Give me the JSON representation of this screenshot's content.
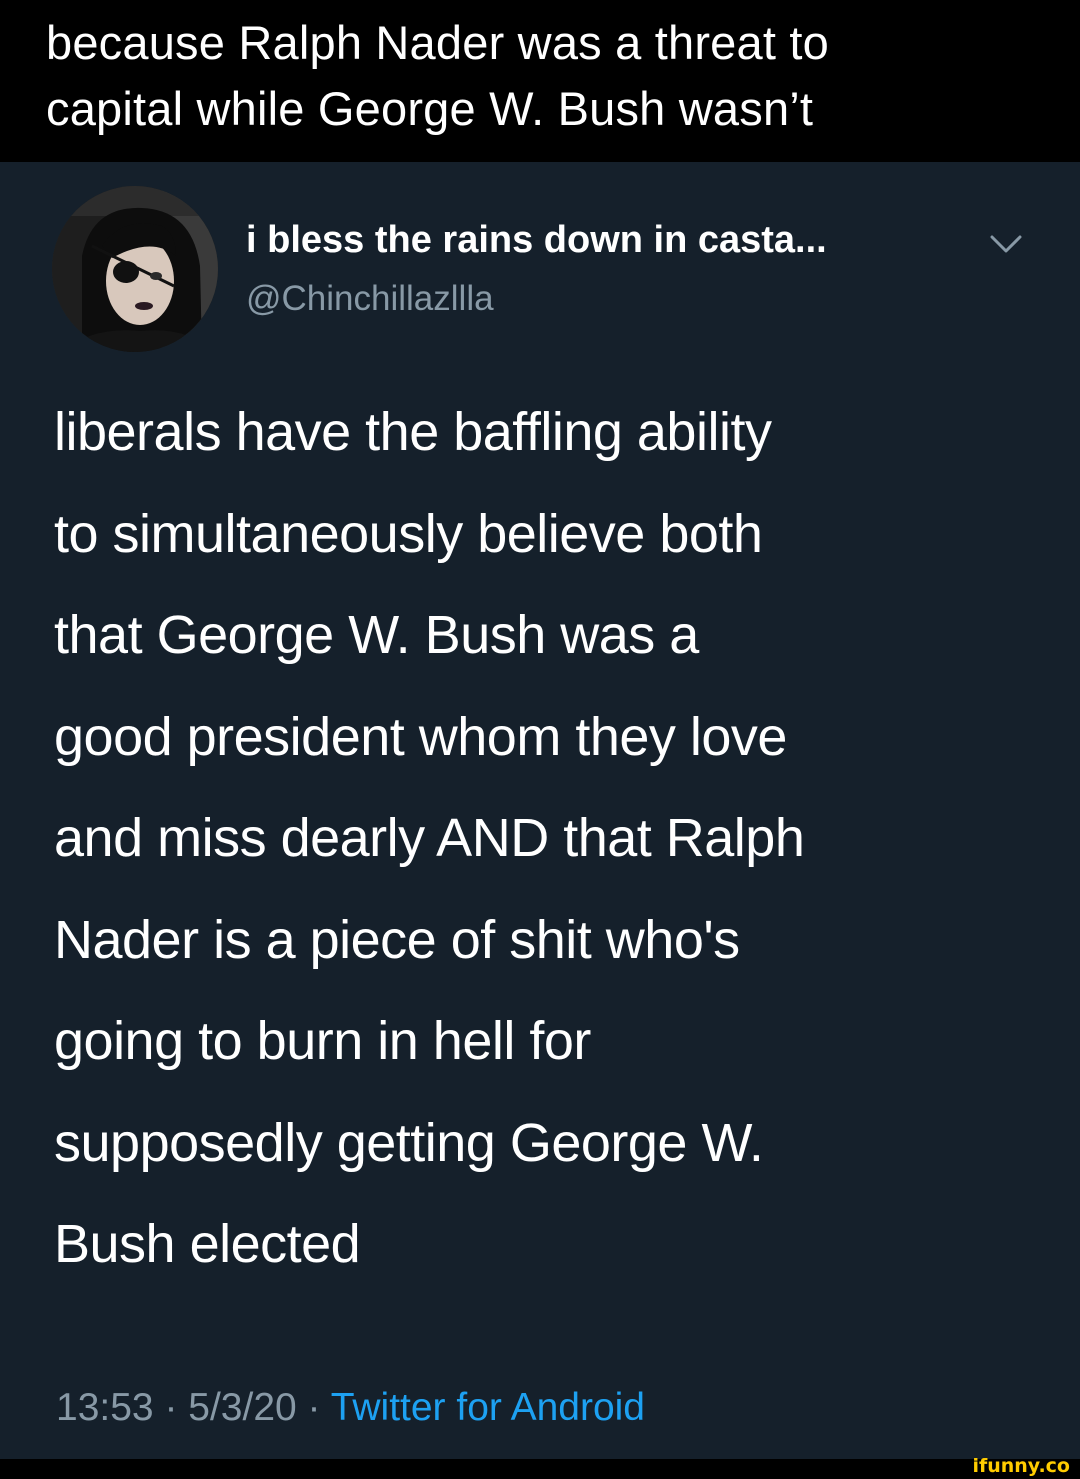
{
  "caption": {
    "line1": "because Ralph Nader was a threat to",
    "line2": "capital while George W. Bush wasn’t"
  },
  "tweet": {
    "display_name": "i bless the rains down in casta...",
    "handle": "@Chinchillazllla",
    "lines": [
      "liberals have the baffling ability",
      "to simultaneously believe both",
      "that George W. Bush was a",
      "good president whom they love",
      "and miss dearly AND that Ralph",
      "Nader is a piece of shit who's",
      "going to burn in hell for",
      "supposedly getting George W.",
      "Bush elected"
    ],
    "time": "13:53",
    "separator": " · ",
    "date": "5/3/20",
    "source": "Twitter for Android"
  },
  "watermark": "ifunny.co",
  "colors": {
    "caption_bg": "#000000",
    "tweet_bg": "#15202b",
    "secondary_text": "#8899a6",
    "link": "#1da1f2",
    "watermark": "#ffcc00"
  },
  "icons": {
    "chevron": "chevron-down-icon",
    "avatar": "avatar"
  }
}
